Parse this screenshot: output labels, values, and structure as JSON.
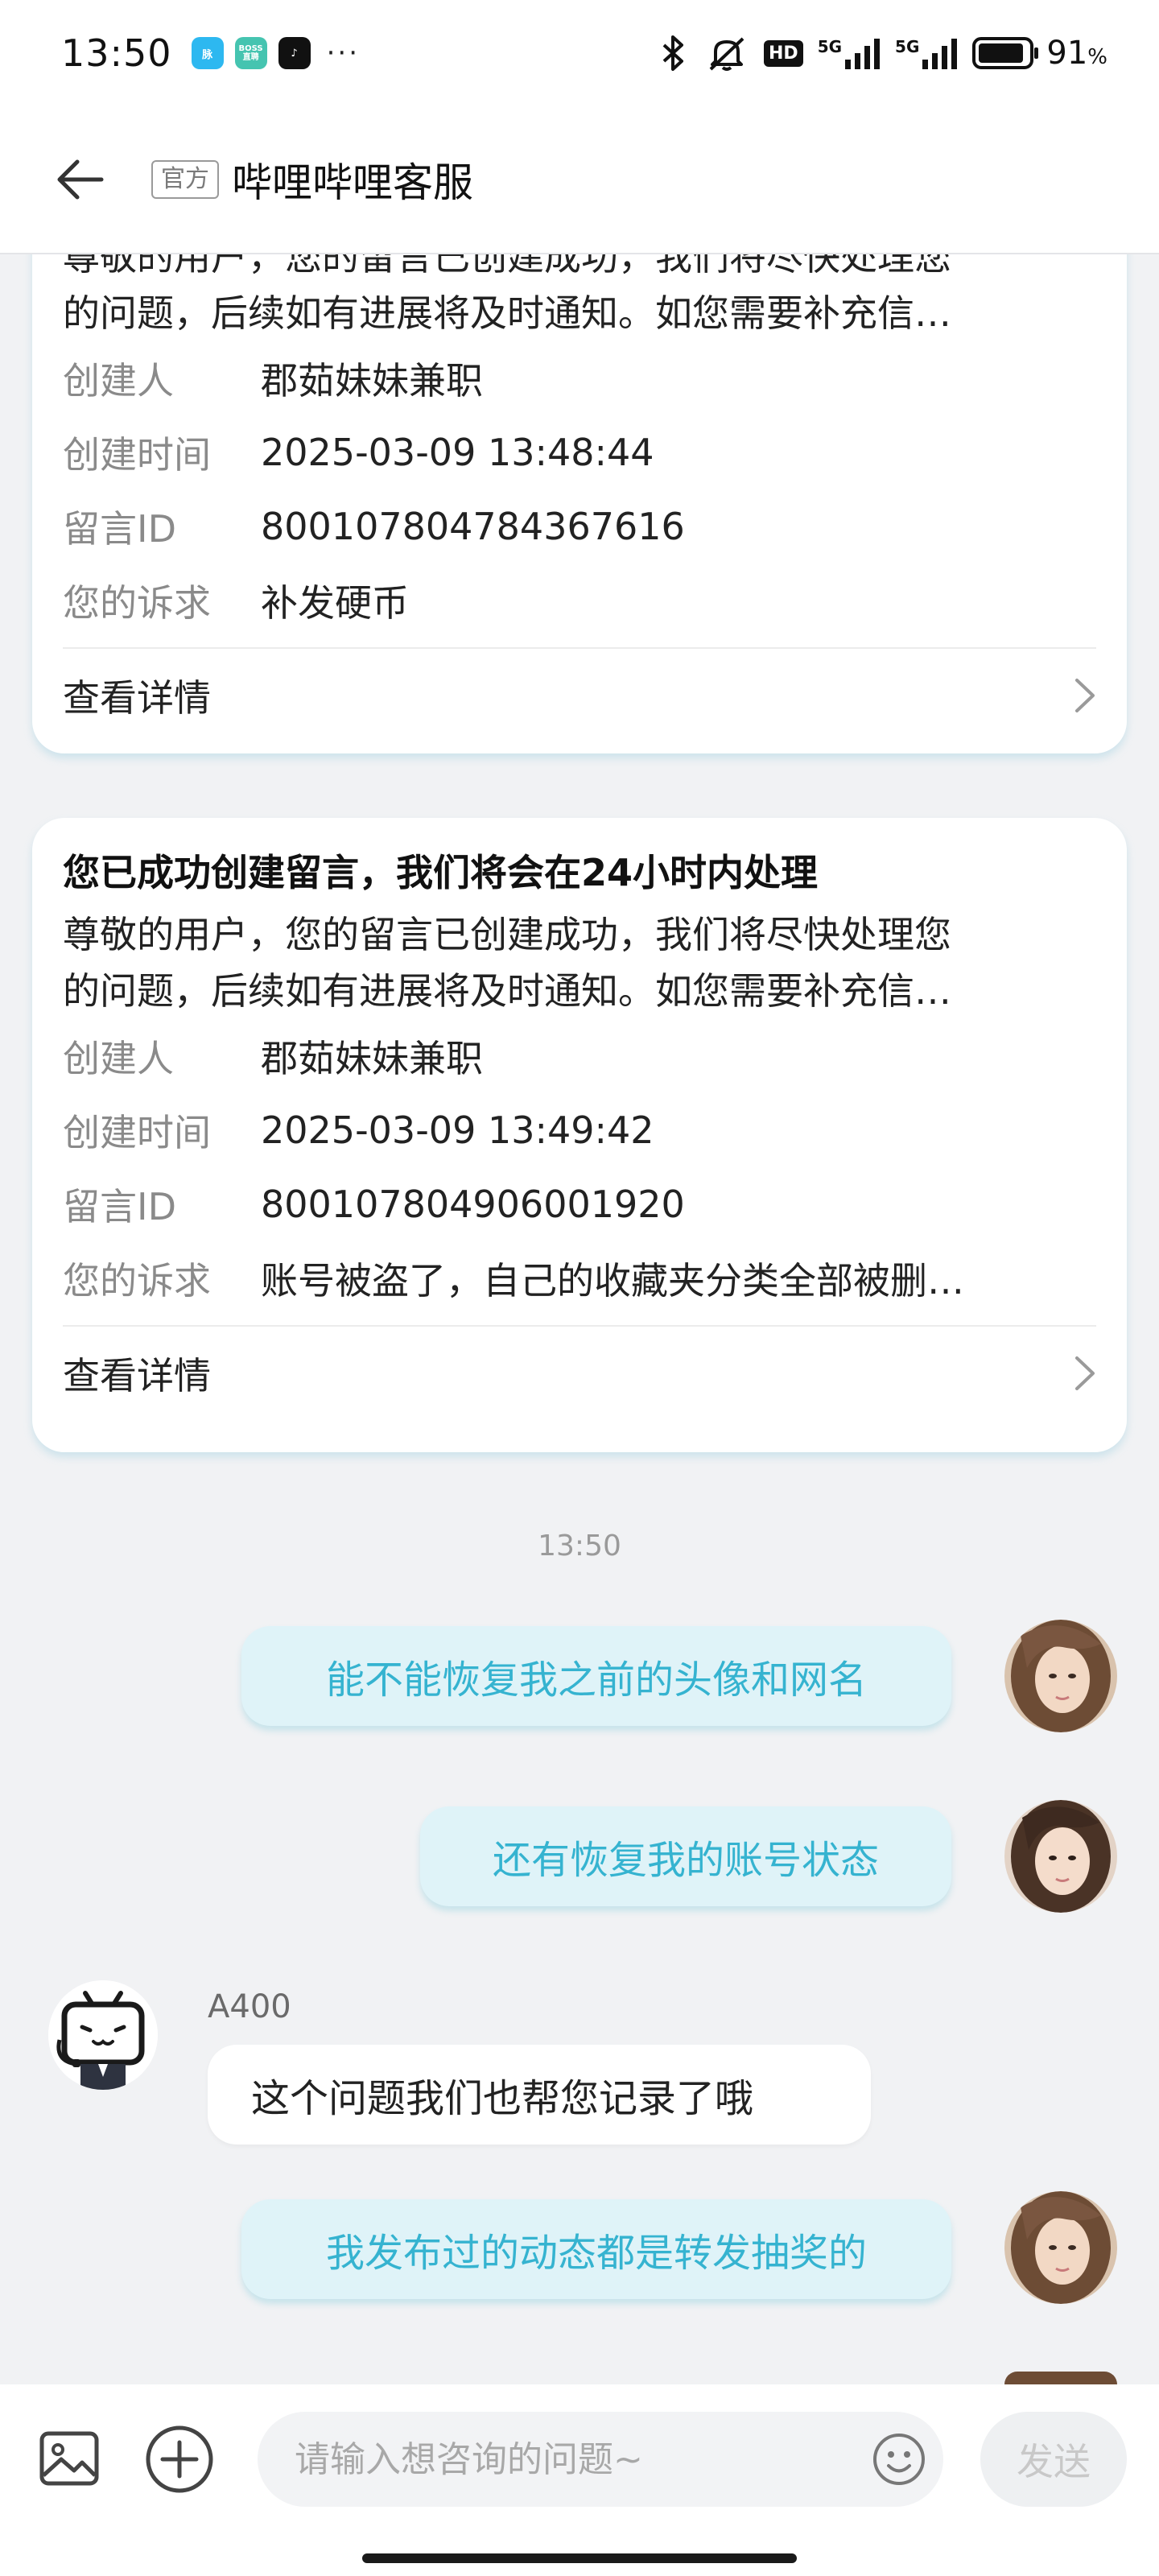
{
  "status_bar": {
    "time": "13:50",
    "app_icons": [
      "maimai-app-icon",
      "boss-zhipin-app-icon",
      "tiktok-app-icon"
    ],
    "app_icon_labels": [
      "脉",
      "BOSS直聘",
      "♪"
    ],
    "more": "···",
    "hd_badge": "HD",
    "network_1": "5G",
    "network_2": "5G",
    "battery_percent": "91",
    "battery_unit": "%",
    "battery_level": 0.91
  },
  "header": {
    "official_tag": "官方",
    "title": "哔哩哔哩客服"
  },
  "cards": [
    {
      "title": "",
      "body_lines": [
        "尊敬的用户，您的留言已创建成功，我们将尽快处理您",
        "的问题，后续如有进展将及时通知。如您需要补充信…"
      ],
      "fields": [
        {
          "label": "创建人",
          "value": "郡茹妹妹兼职"
        },
        {
          "label": "创建时间",
          "value": "2025-03-09 13:48:44"
        },
        {
          "label": "留言ID",
          "value": "800107804784367616"
        },
        {
          "label": "您的诉求",
          "value": "补发硬币"
        }
      ],
      "detail_label": "查看详情"
    },
    {
      "title": "您已成功创建留言，我们将会在24小时内处理",
      "body_lines": [
        "尊敬的用户，您的留言已创建成功，我们将尽快处理您",
        "的问题，后续如有进展将及时通知。如您需要补充信…"
      ],
      "fields": [
        {
          "label": "创建人",
          "value": "郡茹妹妹兼职"
        },
        {
          "label": "创建时间",
          "value": "2025-03-09 13:49:42"
        },
        {
          "label": "留言ID",
          "value": "800107804906001920"
        },
        {
          "label": "您的诉求",
          "value": "账号被盗了，自己的收藏夹分类全部被删…"
        }
      ],
      "detail_label": "查看详情"
    }
  ],
  "chat": {
    "time_separator": "13:50",
    "messages": [
      {
        "from": "user",
        "text": "能不能恢复我之前的头像和网名"
      },
      {
        "from": "user",
        "text": "还有恢复我的账号状态"
      },
      {
        "from": "bot",
        "sender": "A400",
        "text": "这个问题我们也帮您记录了哦"
      },
      {
        "from": "user",
        "text": "我发布过的动态都是转发抽奖的"
      }
    ]
  },
  "input_bar": {
    "placeholder": "请输入想咨询的问题~",
    "send_label": "发送"
  },
  "colors": {
    "user_bubble_bg": "#dff3f8",
    "user_bubble_text": "#35b3d0",
    "page_bg": "#f1f2f4",
    "card_bg": "#ffffff"
  }
}
